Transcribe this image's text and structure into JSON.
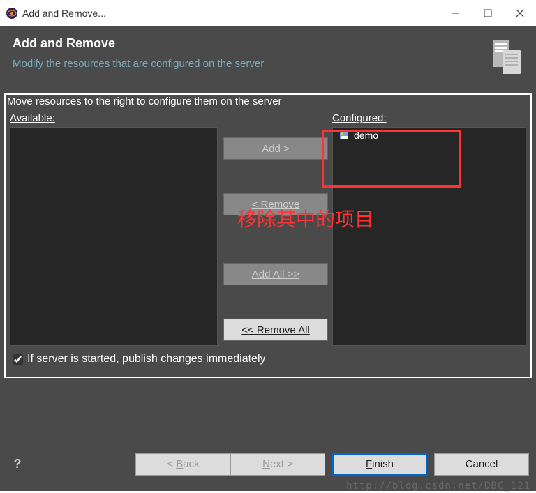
{
  "window": {
    "title": "Add and Remove..."
  },
  "header": {
    "title": "Add and Remove",
    "subtitle": "Modify the resources that are configured on the server"
  },
  "body": {
    "instruction": "Move resources to the right to configure them on the server",
    "available_label": "Available:",
    "configured_label": "Configured:",
    "configured_items": [
      "demo"
    ],
    "buttons": {
      "add": "Add >",
      "remove": "< Remove",
      "add_all": "Add All >>",
      "remove_all": "<< Remove All"
    },
    "checkbox_label_pre": "If server is started, publish changes ",
    "checkbox_label_u": "i",
    "checkbox_label_post": "mmediately",
    "checkbox_checked": true
  },
  "footer": {
    "back": "< Back",
    "next": "Next >",
    "finish": "Finish",
    "cancel": "Cancel"
  },
  "annotation": {
    "text": "移除其中的项目"
  },
  "watermark": "http://blog.csdn.net/DBC_121"
}
